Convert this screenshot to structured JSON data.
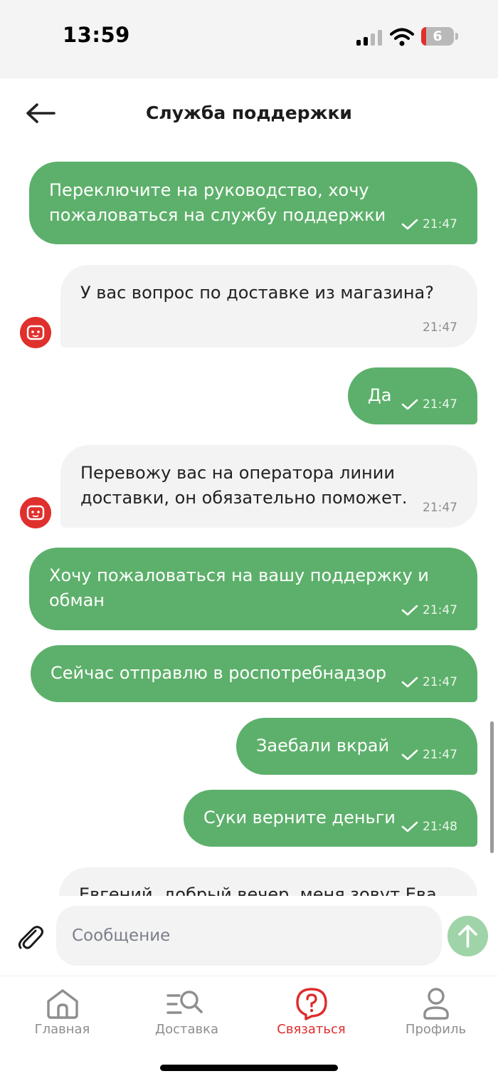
{
  "status": {
    "time": "13:59",
    "battery": "6"
  },
  "header": {
    "title": "Служба поддержки"
  },
  "messages": [
    {
      "text": "Переключите на руководство, хочу\nпожаловаться на службу поддержки",
      "time": "21:47"
    },
    {
      "text": "У вас вопрос по доставке из магазина?",
      "time": "21:47"
    },
    {
      "text": "Да",
      "time": "21:47"
    },
    {
      "text": "Перевожу вас на оператора линии\nдоставки, он обязательно поможет.",
      "time": "21:47"
    },
    {
      "text": "Хочу пожаловаться на вашу поддержку и\nобман",
      "time": "21:47"
    },
    {
      "text": "Сейчас отправлю в роспотребнадзор",
      "time": "21:47"
    },
    {
      "text": "Заебали вкрай",
      "time": "21:47"
    },
    {
      "text": "Суки верните деньги",
      "time": "21:48"
    },
    {
      "text": "Евгений, добрый вечер, меня зовут Ева"
    }
  ],
  "composer": {
    "placeholder": "Сообщение"
  },
  "tabs": [
    {
      "label": "Главная",
      "icon": "home-icon"
    },
    {
      "label": "Доставка",
      "icon": "delivery-search-icon"
    },
    {
      "label": "Связаться",
      "icon": "support-chat-icon"
    },
    {
      "label": "Профиль",
      "icon": "profile-icon"
    }
  ],
  "colors": {
    "outgoing": "#5db06b",
    "incoming": "#f3f3f3",
    "accent": "#dd2c2c",
    "send": "#9fd4a8"
  }
}
